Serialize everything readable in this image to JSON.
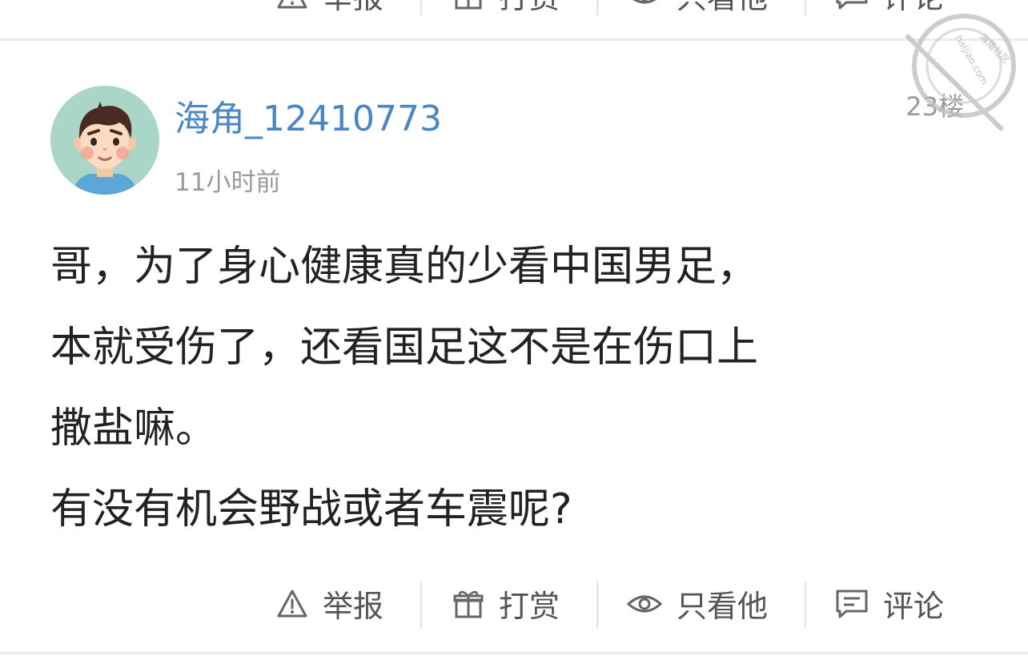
{
  "top_bar": {
    "report_label": "举报",
    "tip_label": "打赏",
    "only_him_label": "只看他",
    "comment_label": "评论"
  },
  "post": {
    "username": "海角_12410773",
    "time": "11小时前",
    "floor": "23楼",
    "lines": [
      "哥，为了身心健康真的少看中国男足，",
      "本就受伤了，还看国足这不是在伤口上",
      "撒盐嘛。",
      "有没有机会野战或者车震呢?"
    ]
  },
  "bottom_bar": {
    "report_label": "举报",
    "tip_label": "打赏",
    "only_him_label": "只看他",
    "comment_label": "评论"
  },
  "watermark": {
    "site_cn": "海角社区",
    "site_url": "haijiao.com"
  },
  "colors": {
    "username": "#4a86c5",
    "meta": "#9a9a9a",
    "body_text": "#222222",
    "action_text": "#555555",
    "divider": "#ececec",
    "avatar_bg": "#a9d6c6"
  },
  "icons": {
    "report": "warning-triangle-icon",
    "tip": "gift-icon",
    "only_him": "eye-icon",
    "comment": "comment-icon"
  }
}
